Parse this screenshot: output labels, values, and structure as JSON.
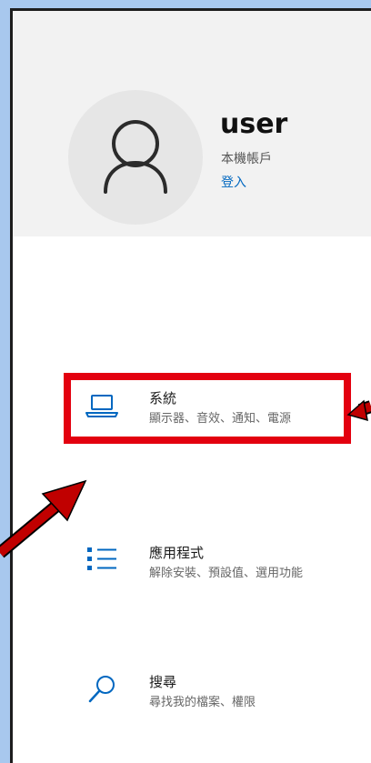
{
  "account": {
    "username": "user",
    "account_type": "本機帳戶",
    "signin_link": "登入"
  },
  "menu": [
    {
      "title": "系統",
      "description": "顯示器、音效、通知、電源",
      "icon": "laptop-icon"
    },
    {
      "title": "應用程式",
      "description": "解除安裝、預設值、選用功能",
      "icon": "apps-list-icon"
    },
    {
      "title": "搜尋",
      "description": "尋找我的檔案、權限",
      "icon": "search-icon"
    }
  ],
  "colors": {
    "accent": "#0067c0",
    "highlight": "#e3000f",
    "arrow": "#c00000",
    "background": "#a8c8ee"
  }
}
